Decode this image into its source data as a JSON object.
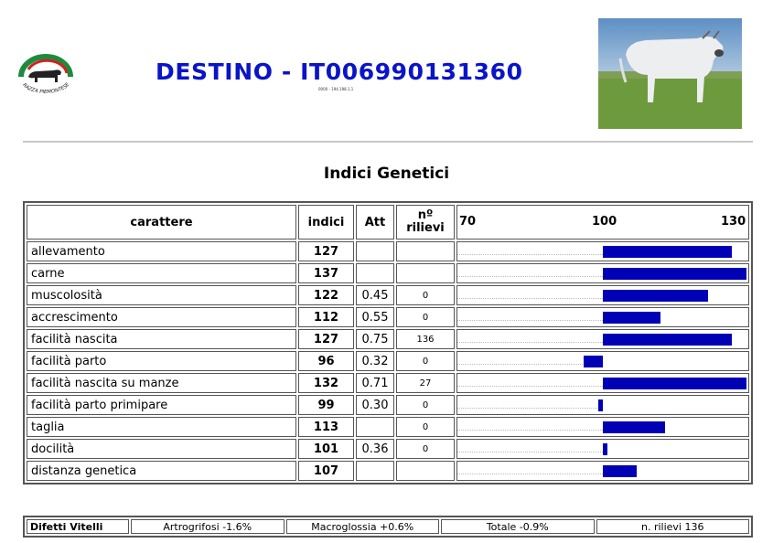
{
  "header": {
    "title": "DESTINO - IT006990131360",
    "subtitle": "0000 - 194.198.1.1",
    "logo_text": "RAZZA PIEMONTESE",
    "colors": {
      "title": "#0a14c8",
      "bar": "#0000b4",
      "logo_green": "#1c8c3c",
      "logo_red": "#d42020"
    }
  },
  "section": {
    "title": "Indici Genetici"
  },
  "table": {
    "headers": {
      "carattere": "carattere",
      "indici": "indici",
      "att": "Att",
      "rilievi": "nº rilievi"
    },
    "scale": {
      "min": 70,
      "mid": 100,
      "max": 130,
      "labels": [
        "70",
        "100",
        "130"
      ]
    },
    "rows": [
      {
        "carattere": "allevamento",
        "indici": "127",
        "att": "",
        "rilievi": ""
      },
      {
        "carattere": "carne",
        "indici": "137",
        "att": "",
        "rilievi": ""
      },
      {
        "carattere": "muscolosità",
        "indici": "122",
        "att": "0.45",
        "rilievi": "0"
      },
      {
        "carattere": "accrescimento",
        "indici": "112",
        "att": "0.55",
        "rilievi": "0"
      },
      {
        "carattere": "facilità nascita",
        "indici": "127",
        "att": "0.75",
        "rilievi": "136"
      },
      {
        "carattere": "facilità parto",
        "indici": "96",
        "att": "0.32",
        "rilievi": "0"
      },
      {
        "carattere": "facilità nascita su manze",
        "indici": "132",
        "att": "0.71",
        "rilievi": "27"
      },
      {
        "carattere": "facilità parto primipare",
        "indici": "99",
        "att": "0.30",
        "rilievi": "0"
      },
      {
        "carattere": "taglia",
        "indici": "113",
        "att": "",
        "rilievi": "0"
      },
      {
        "carattere": "docilità",
        "indici": "101",
        "att": "0.36",
        "rilievi": "0"
      },
      {
        "carattere": "distanza genetica",
        "indici": "107",
        "att": "",
        "rilievi": ""
      }
    ]
  },
  "defects": {
    "label": "Difetti Vitelli",
    "items": [
      "Artrogrifosi -1.6%",
      "Macroglossia +0.6%",
      "Totale -0.9%",
      "n. rilievi 136"
    ]
  }
}
